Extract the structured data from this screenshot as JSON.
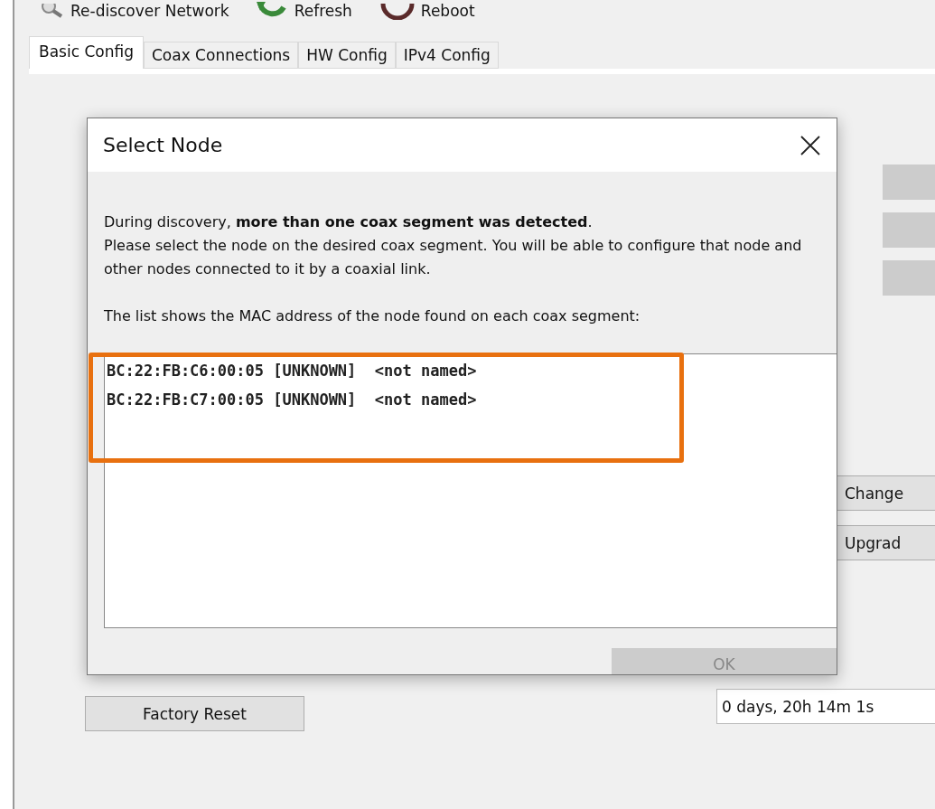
{
  "toolbar": [
    {
      "label": "Re-discover Network",
      "kind": "search"
    },
    {
      "label": "Refresh",
      "kind": "refresh"
    },
    {
      "label": "Reboot",
      "kind": "reboot"
    }
  ],
  "tabs": [
    {
      "label": "Basic Config",
      "selected": true
    },
    {
      "label": "Coax Connections",
      "selected": false
    },
    {
      "label": "HW Config",
      "selected": false
    },
    {
      "label": "IPv4 Config",
      "selected": false
    }
  ],
  "panel": {
    "side_buttons": [
      "Change",
      "Upgrad"
    ],
    "factory_reset": "Factory Reset",
    "uptime_value": "0 days, 20h 14m 1s"
  },
  "dialog": {
    "title": "Select Node",
    "intro": "During discovery, **more than one coax segment was detected**.",
    "instructions": "Please select the node on the desired coax segment. You will be able to configure that node and other nodes connected to it by a coaxial link.",
    "list_caption": "The list shows the MAC address of the node found on each coax segment:",
    "nodes": [
      {
        "mac": "BC:22:FB:C6:00:05",
        "type": "[UNKNOWN]",
        "name": "<not named>",
        "selected": false
      },
      {
        "mac": "BC:22:FB:C7:00:05",
        "type": "[UNKNOWN]",
        "name": "<not named>",
        "selected": false
      }
    ],
    "ok_button": {
      "label": "OK",
      "disabled": true
    }
  }
}
